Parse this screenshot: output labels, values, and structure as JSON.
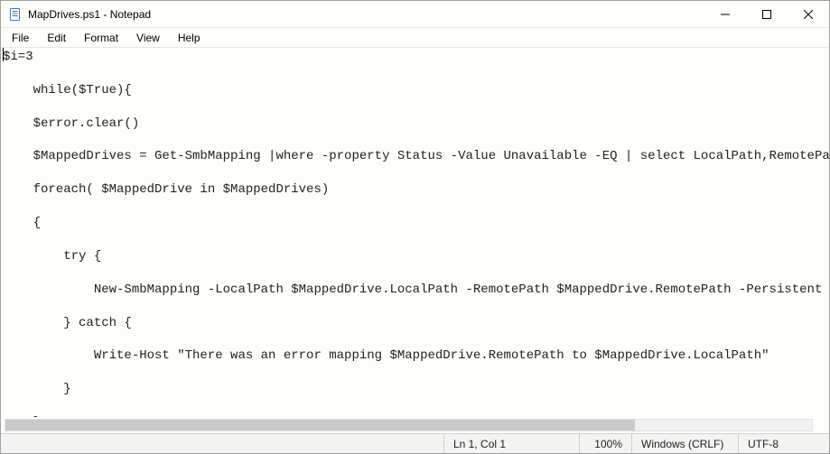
{
  "window": {
    "title": "MapDrives.ps1 - Notepad",
    "icon_name": "notepad-icon"
  },
  "menu": {
    "file": "File",
    "edit": "Edit",
    "format": "Format",
    "view": "View",
    "help": "Help"
  },
  "editor": {
    "lines": [
      "$i=3",
      "",
      "    while($True){",
      "",
      "    $error.clear()",
      "",
      "    $MappedDrives = Get-SmbMapping |where -property Status -Value Unavailable -EQ | select LocalPath,RemotePath",
      "",
      "    foreach( $MappedDrive in $MappedDrives)",
      "",
      "    {",
      "",
      "        try {",
      "",
      "            New-SmbMapping -LocalPath $MappedDrive.LocalPath -RemotePath $MappedDrive.RemotePath -Persistent $Tr",
      "",
      "        } catch {",
      "",
      "            Write-Host \"There was an error mapping $MappedDrive.RemotePath to $MappedDrive.LocalPath\"",
      "",
      "        }",
      "",
      "    }"
    ]
  },
  "status": {
    "cursor": "Ln 1, Col 1",
    "zoom": "100%",
    "eol": "Windows (CRLF)",
    "encoding": "UTF-8"
  }
}
